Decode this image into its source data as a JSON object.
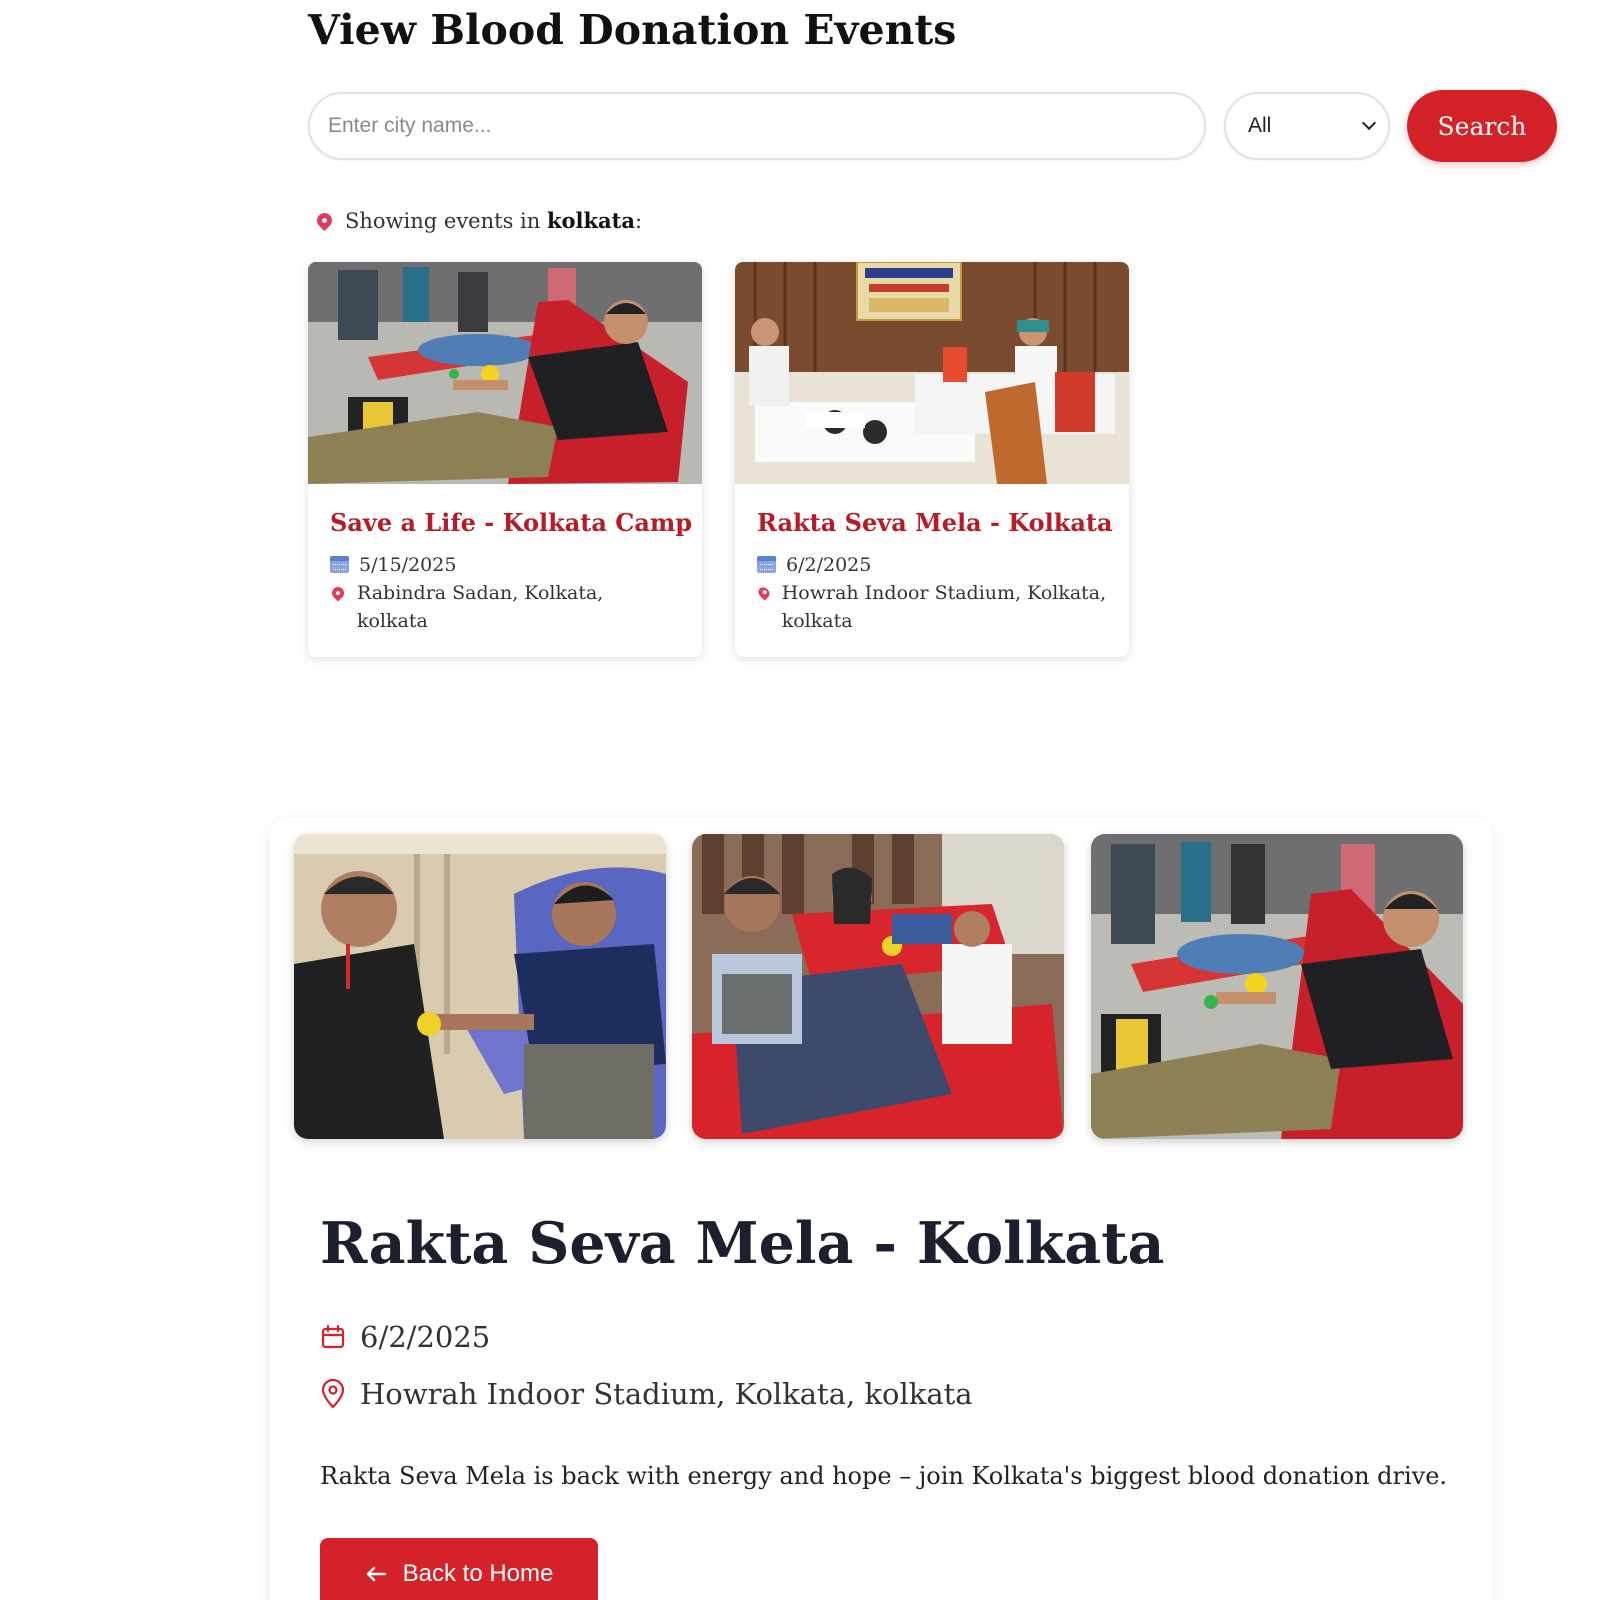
{
  "page": {
    "title": "View Blood Donation Events"
  },
  "search": {
    "placeholder": "Enter city name...",
    "value": "",
    "filter_selected": "All",
    "button_label": "Search"
  },
  "results_header": {
    "prefix": "Showing events in",
    "city": "kolkata",
    "suffix": ":"
  },
  "events": [
    {
      "title": "Save a Life - Kolkata Camp",
      "date": "5/15/2025",
      "location": "Rabindra Sadan, Kolkata, kolkata"
    },
    {
      "title": "Rakta Seva Mela - Kolkata",
      "date": "6/2/2025",
      "location": "Howrah Indoor Stadium, Kolkata, kolkata"
    }
  ],
  "detail": {
    "title": "Rakta Seva Mela - Kolkata",
    "date": "6/2/2025",
    "location": "Howrah Indoor Stadium, Kolkata, kolkata",
    "description": "Rakta Seva Mela is back with energy and hope – join Kolkata's biggest blood donation drive.",
    "back_label": "Back to Home"
  },
  "icons": {
    "location": "map-pin-icon",
    "calendar": "calendar-icon",
    "back": "arrow-left-icon",
    "select": "chevron-down-icon"
  },
  "colors": {
    "accent": "#d42228",
    "card_title": "#b71c24",
    "pin": "#e53958"
  }
}
